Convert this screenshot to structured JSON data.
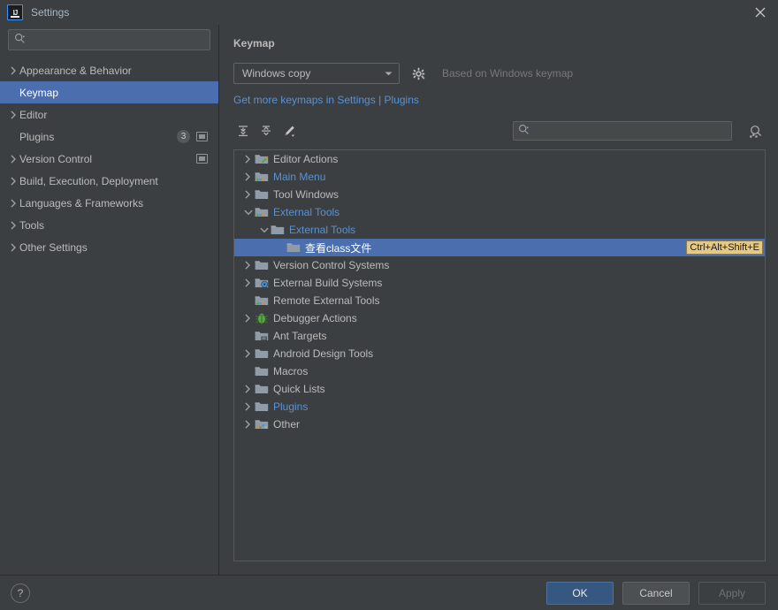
{
  "window": {
    "title": "Settings",
    "logo_icon": "intellij-idea-logo",
    "close_icon": "close-icon"
  },
  "sidebar": {
    "search": {
      "value": "",
      "placeholder": "",
      "icon": "search-icon"
    },
    "items": [
      {
        "label": "Appearance & Behavior",
        "expandable": true,
        "selected": false,
        "badge": null,
        "trailing_icon": null
      },
      {
        "label": "Keymap",
        "expandable": false,
        "selected": true,
        "badge": null,
        "trailing_icon": null
      },
      {
        "label": "Editor",
        "expandable": true,
        "selected": false,
        "badge": null,
        "trailing_icon": null
      },
      {
        "label": "Plugins",
        "expandable": false,
        "selected": false,
        "badge": "3",
        "trailing_icon": "project-scope-icon"
      },
      {
        "label": "Version Control",
        "expandable": true,
        "selected": false,
        "badge": null,
        "trailing_icon": "project-scope-icon"
      },
      {
        "label": "Build, Execution, Deployment",
        "expandable": true,
        "selected": false,
        "badge": null,
        "trailing_icon": null
      },
      {
        "label": "Languages & Frameworks",
        "expandable": true,
        "selected": false,
        "badge": null,
        "trailing_icon": null
      },
      {
        "label": "Tools",
        "expandable": true,
        "selected": false,
        "badge": null,
        "trailing_icon": null
      },
      {
        "label": "Other Settings",
        "expandable": true,
        "selected": false,
        "badge": null,
        "trailing_icon": null
      }
    ]
  },
  "content": {
    "page_title": "Keymap",
    "keymap_select": {
      "value": "Windows copy",
      "dropdown_icon": "chevron-down-icon"
    },
    "gear_icon": "gear-icon",
    "based_on_text": "Based on Windows keymap",
    "get_more_link": "Get more keymaps in Settings | Plugins",
    "toolbar": {
      "expand_all_icon": "expand-all-icon",
      "collapse_all_icon": "collapse-all-icon",
      "edit_shortcut_icon": "edit-pencil-icon",
      "search": {
        "value": "",
        "placeholder": "",
        "icon": "search-icon"
      },
      "find_by_shortcut_icon": "find-by-shortcut-icon"
    },
    "tree": [
      {
        "label": "Editor Actions",
        "depth": 0,
        "expandable": true,
        "expanded": false,
        "selected": false,
        "icon": "editor-actions-folder-icon",
        "blue": false,
        "shortcut": null
      },
      {
        "label": "Main Menu",
        "depth": 0,
        "expandable": true,
        "expanded": false,
        "selected": false,
        "icon": "main-menu-folder-icon",
        "blue": true,
        "shortcut": null
      },
      {
        "label": "Tool Windows",
        "depth": 0,
        "expandable": true,
        "expanded": false,
        "selected": false,
        "icon": "folder-icon",
        "blue": false,
        "shortcut": null
      },
      {
        "label": "External Tools",
        "depth": 0,
        "expandable": true,
        "expanded": true,
        "selected": false,
        "icon": "external-tools-folder-icon",
        "blue": true,
        "shortcut": null
      },
      {
        "label": "External Tools",
        "depth": 1,
        "expandable": true,
        "expanded": true,
        "selected": false,
        "icon": "folder-icon",
        "blue": true,
        "shortcut": null
      },
      {
        "label": "查看class文件",
        "depth": 2,
        "expandable": false,
        "expanded": false,
        "selected": true,
        "icon": "folder-icon",
        "blue": false,
        "shortcut": "Ctrl+Alt+Shift+E"
      },
      {
        "label": "Version Control Systems",
        "depth": 0,
        "expandable": true,
        "expanded": false,
        "selected": false,
        "icon": "folder-icon",
        "blue": false,
        "shortcut": null
      },
      {
        "label": "External Build Systems",
        "depth": 0,
        "expandable": true,
        "expanded": false,
        "selected": false,
        "icon": "build-folder-icon",
        "blue": false,
        "shortcut": null
      },
      {
        "label": "Remote External Tools",
        "depth": 0,
        "expandable": false,
        "expanded": false,
        "selected": false,
        "icon": "external-tools-folder-icon",
        "blue": false,
        "shortcut": null
      },
      {
        "label": "Debugger Actions",
        "depth": 0,
        "expandable": true,
        "expanded": false,
        "selected": false,
        "icon": "debugger-bug-icon",
        "blue": false,
        "shortcut": null
      },
      {
        "label": "Ant Targets",
        "depth": 0,
        "expandable": false,
        "expanded": false,
        "selected": false,
        "icon": "ant-folder-icon",
        "blue": false,
        "shortcut": null
      },
      {
        "label": "Android Design Tools",
        "depth": 0,
        "expandable": true,
        "expanded": false,
        "selected": false,
        "icon": "folder-icon",
        "blue": false,
        "shortcut": null
      },
      {
        "label": "Macros",
        "depth": 0,
        "expandable": false,
        "expanded": false,
        "selected": false,
        "icon": "folder-icon",
        "blue": false,
        "shortcut": null
      },
      {
        "label": "Quick Lists",
        "depth": 0,
        "expandable": true,
        "expanded": false,
        "selected": false,
        "icon": "folder-icon",
        "blue": false,
        "shortcut": null
      },
      {
        "label": "Plugins",
        "depth": 0,
        "expandable": true,
        "expanded": false,
        "selected": false,
        "icon": "folder-icon",
        "blue": true,
        "shortcut": null
      },
      {
        "label": "Other",
        "depth": 0,
        "expandable": true,
        "expanded": false,
        "selected": false,
        "icon": "other-folder-icon",
        "blue": false,
        "shortcut": null
      }
    ]
  },
  "footer": {
    "help_label": "?",
    "ok_label": "OK",
    "cancel_label": "Cancel",
    "apply_label": "Apply"
  },
  "colors": {
    "selection_blue": "#4b6eaf",
    "link_blue": "#5992d4",
    "shortcut_badge_bg": "#e5c884",
    "primary_button": "#365880",
    "window_bg": "#3c3f41"
  }
}
